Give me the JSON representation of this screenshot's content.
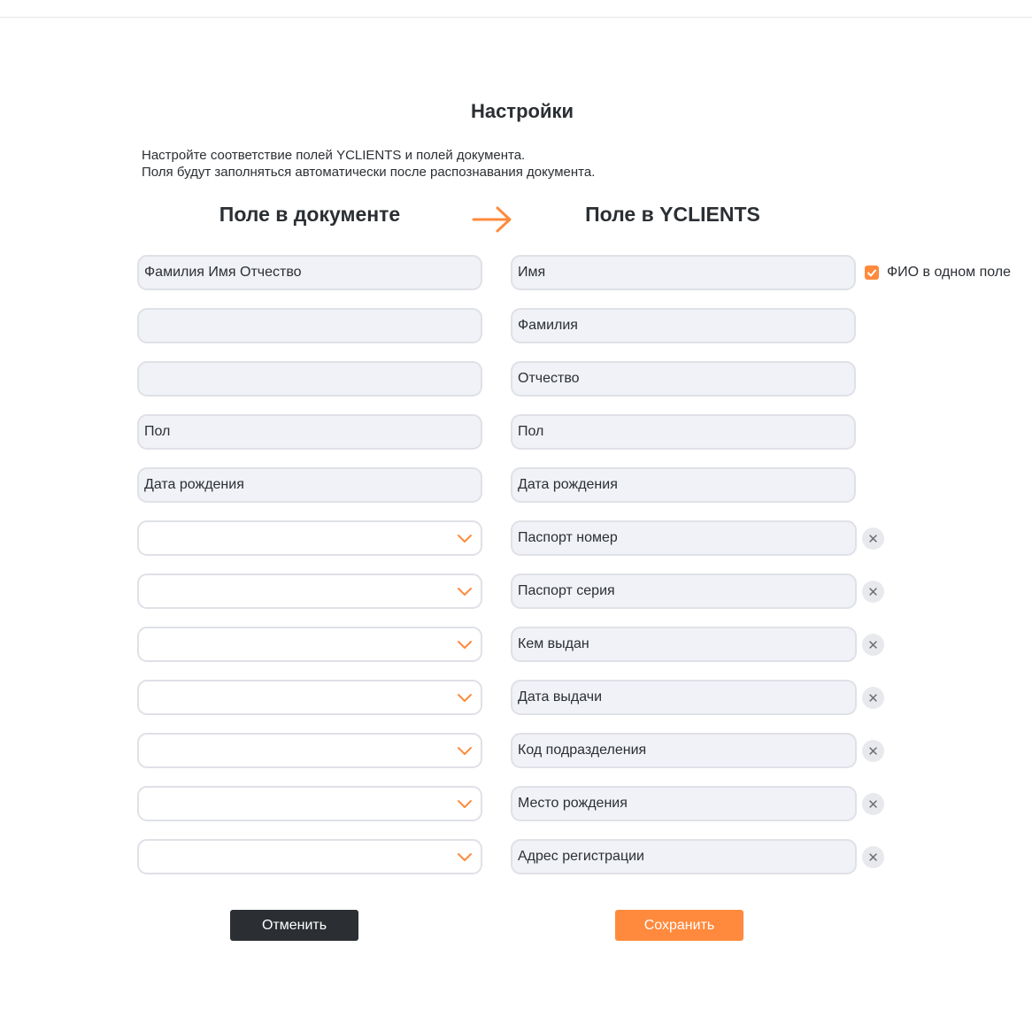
{
  "page": {
    "title": "Настройки",
    "description_line1": "Настройте соответствие полей YCLIENTS и полей документа.",
    "description_line2": "Поля будут заполняться автоматически после распознавания документа."
  },
  "columns": {
    "document_header": "Поле в документе",
    "yclients_header": "Поле в YCLIENTS"
  },
  "fio_checkbox": {
    "label": "ФИО в одном поле",
    "checked": true
  },
  "rows": [
    {
      "document": "Фамилия Имя Отчество",
      "yclients": "Имя",
      "document_type": "text"
    },
    {
      "document": "",
      "yclients": "Фамилия",
      "document_type": "text"
    },
    {
      "document": "",
      "yclients": "Отчество",
      "document_type": "text"
    },
    {
      "document": "Пол",
      "yclients": "Пол",
      "document_type": "text"
    },
    {
      "document": "Дата рождения",
      "yclients": "Дата рождения",
      "document_type": "text"
    },
    {
      "document": "",
      "yclients": "Паспорт номер",
      "document_type": "select",
      "removable": true
    },
    {
      "document": "",
      "yclients": "Паспорт серия",
      "document_type": "select",
      "removable": true
    },
    {
      "document": "",
      "yclients": "Кем выдан",
      "document_type": "select",
      "removable": true
    },
    {
      "document": "",
      "yclients": "Дата выдачи",
      "document_type": "select",
      "removable": true
    },
    {
      "document": "",
      "yclients": "Код подразделения",
      "document_type": "select",
      "removable": true
    },
    {
      "document": "",
      "yclients": "Место рождения",
      "document_type": "select",
      "removable": true
    },
    {
      "document": "",
      "yclients": "Адрес регистрации",
      "document_type": "select",
      "removable": true
    }
  ],
  "buttons": {
    "cancel_label": "Отменить",
    "save_label": "Сохранить"
  },
  "colors": {
    "accent": "#ff8a3d",
    "dark": "#2b2f33",
    "field_bg": "#f0f2f7"
  },
  "icons": {
    "arrow": "arrow-right-icon",
    "chevron": "chevron-down-icon",
    "remove": "close-icon",
    "check": "check-icon"
  }
}
